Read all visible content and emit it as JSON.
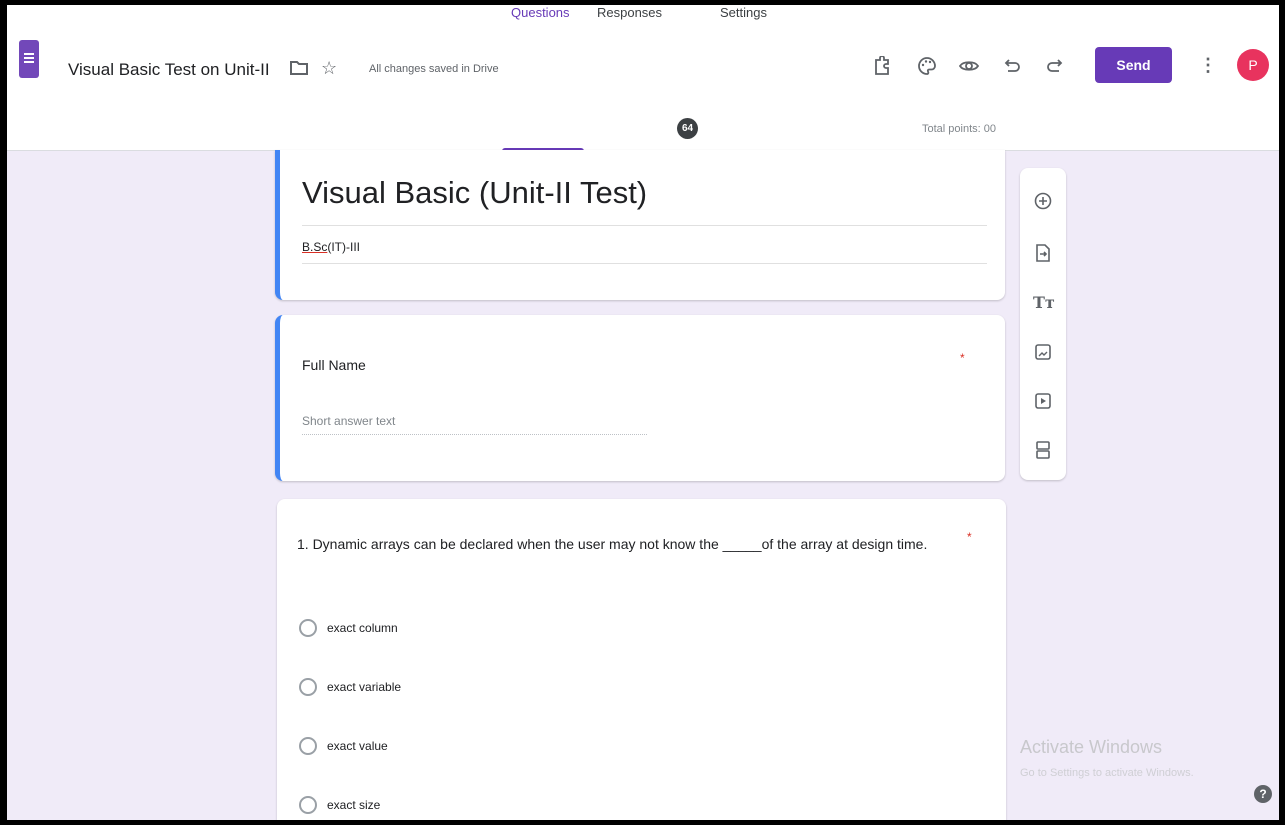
{
  "header": {
    "doc_title": "Visual Basic Test on Unit-II",
    "saved_status": "All changes saved in Drive",
    "send_label": "Send",
    "avatar_letter": "P",
    "icons": [
      "folder-icon",
      "star-icon",
      "addon-icon",
      "palette-icon",
      "eye-icon",
      "undo-icon",
      "redo-icon",
      "more-vert-icon"
    ]
  },
  "tabs": {
    "questions": "Questions",
    "responses": "Responses",
    "responses_count": "64",
    "settings": "Settings",
    "total_points": "Total points: 00"
  },
  "form": {
    "title": "Visual Basic (Unit-II Test)",
    "description_main": "B.Sc",
    "description_rest": "(IT)-III"
  },
  "name_question": {
    "label": "Full Name",
    "required": "*",
    "placeholder": "Short answer text"
  },
  "question1": {
    "text": "1. Dynamic arrays can be declared when the user may not know the _____of the array at design time.",
    "required": "*",
    "options": [
      "exact column",
      "exact variable",
      "exact value",
      "exact size"
    ]
  },
  "toolbar": {
    "icons": [
      "add-question-icon",
      "import-questions-icon",
      "add-title-icon",
      "add-image-icon",
      "add-video-icon",
      "add-section-icon"
    ],
    "title_glyph": "Tт"
  },
  "watermark": {
    "title": "Activate Windows",
    "subtitle": "Go to Settings to activate Windows."
  },
  "help_glyph": "?",
  "colors": {
    "accent": "#673ab7",
    "card_border": "#4285f4",
    "avatar": "#e8335e",
    "background": "#f0ebf8"
  }
}
